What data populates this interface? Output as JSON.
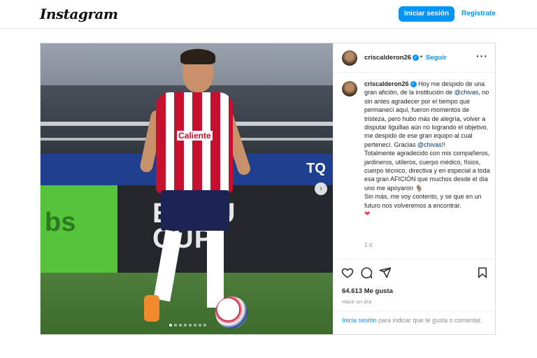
{
  "header": {
    "logo": "Instagram",
    "login_label": "Iniciar sesión",
    "register_label": "Regístrate"
  },
  "media": {
    "alt_text": "Jugador de Chivas conduciendo el balón",
    "sponsor_text": "Caliente",
    "board_text_1": "bs",
    "board_text_2": "EAGU\nCUP",
    "board_text_3": "TQ",
    "carousel_dots": 8,
    "active_dot": 0
  },
  "post": {
    "username": "criscalderon26",
    "separator": "•",
    "follow_label": "Seguir",
    "more_icon": "more-horizontal-icon",
    "caption_parts": {
      "p1": "Hoy me despido de una gran afición, de la institución de ",
      "mention1": "@chivas",
      "p2": ", no sin antes agradecer por el tiempo que permanecí aquí, fueron momentos de tristeza, pero hubo más de alegría, volver a disputar liguillas aún no logrando el objetivo, me despido de ese gran equipo al cual pertenecí. Gracias ",
      "mention2": "@chivas",
      "p3": "!!",
      "p4": "Totalmente agradecido con mis compañeros, jardineros, utileros, cuerpo médico, físios, cuerpo técnico, directiva y en especial a toda esa gran AFICIÓN que muchos desde el día uno me apoyaron 🐐",
      "p5": "Sin más, me voy contento, y se que en un futuro nos volveremos a encontrar.",
      "heart": "❤"
    },
    "time_ago": "1 d",
    "likes": "64.613 Me gusta",
    "date": "Hace un día",
    "login_hint_link": "Inicia sesión",
    "login_hint_rest": " para indicar que te gusta o comentar."
  },
  "colors": {
    "accent": "#0095f6",
    "border": "#dbdbdb",
    "text": "#262626",
    "muted": "#8e8e8e"
  }
}
